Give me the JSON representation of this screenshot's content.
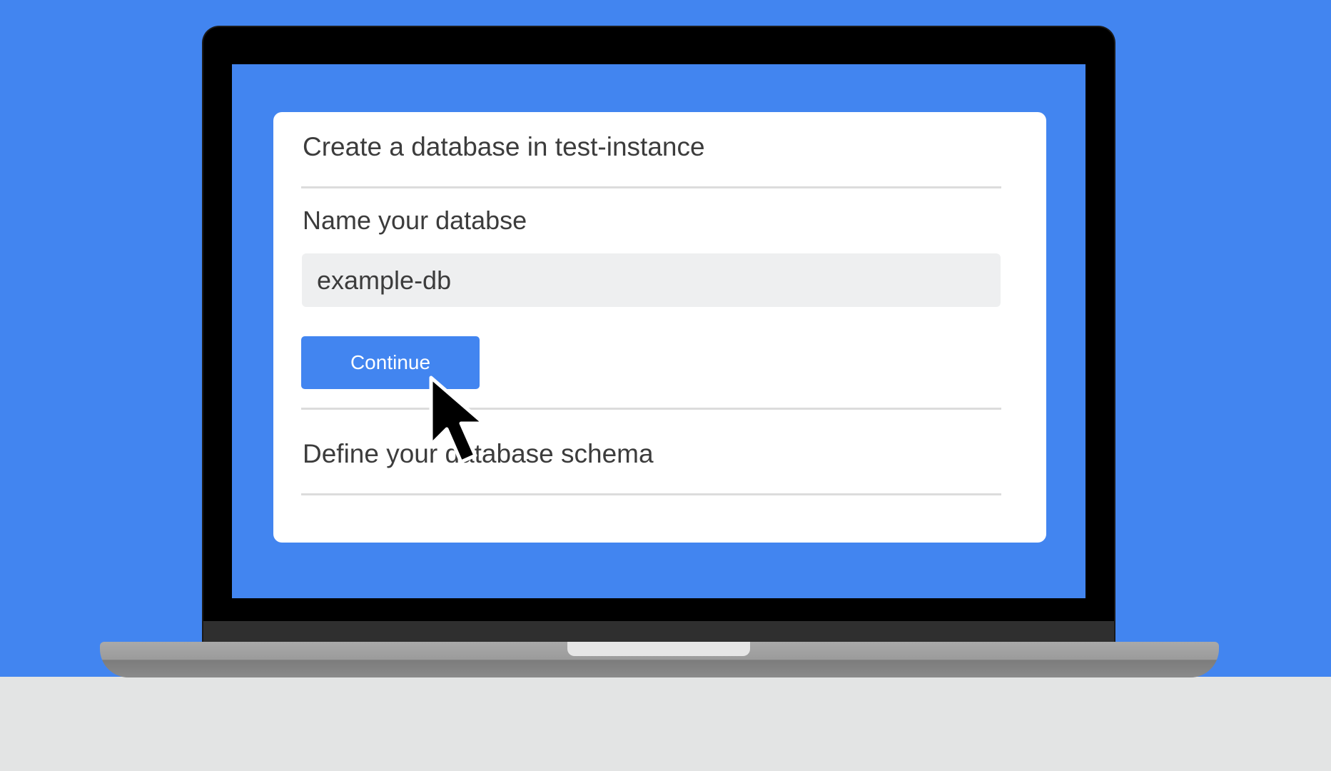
{
  "dialog": {
    "title": "Create a database in test-instance",
    "name_label": "Name your databse",
    "name_value": "example-db",
    "continue_label": "Continue",
    "next_section": "Define your database schema"
  },
  "icons": {
    "cursor": "mouse-pointer-icon"
  },
  "colors": {
    "background": "#4285F0",
    "button": "#4285F0",
    "card": "#FFFFFF",
    "input_bg": "#EEEFF0",
    "floor": "#E3E4E4"
  }
}
